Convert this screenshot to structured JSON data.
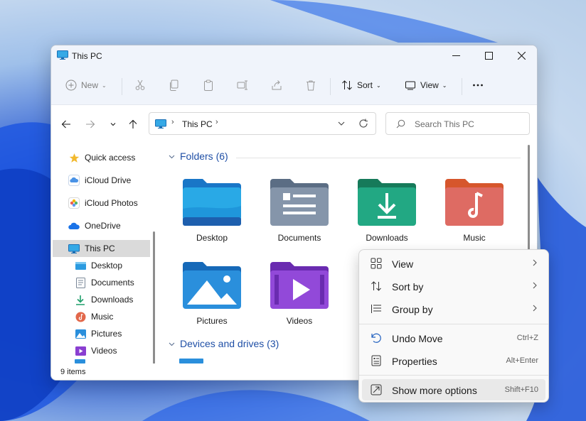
{
  "window": {
    "title": "This PC"
  },
  "toolbar": {
    "new_label": "New",
    "sort_label": "Sort",
    "view_label": "View"
  },
  "address": {
    "path_item": "This PC"
  },
  "search": {
    "placeholder": "Search This PC"
  },
  "sidebar": {
    "items": [
      {
        "label": "Quick access",
        "icon": "star-icon"
      },
      {
        "label": "iCloud Drive",
        "icon": "icloud-icon"
      },
      {
        "label": "iCloud Photos",
        "icon": "photos-icon"
      },
      {
        "label": "OneDrive",
        "icon": "onedrive-icon"
      },
      {
        "label": "This PC",
        "icon": "monitor-icon",
        "selected": true
      },
      {
        "label": "Desktop",
        "icon": "desktop-icon"
      },
      {
        "label": "Documents",
        "icon": "documents-icon"
      },
      {
        "label": "Downloads",
        "icon": "download-icon"
      },
      {
        "label": "Music",
        "icon": "music-icon"
      },
      {
        "label": "Pictures",
        "icon": "pictures-icon"
      },
      {
        "label": "Videos",
        "icon": "videos-icon"
      }
    ]
  },
  "main": {
    "folders_header": "Folders (6)",
    "drives_header": "Devices and drives (3)",
    "folders": [
      {
        "label": "Desktop"
      },
      {
        "label": "Documents"
      },
      {
        "label": "Downloads"
      },
      {
        "label": "Music"
      },
      {
        "label": "Pictures"
      },
      {
        "label": "Videos"
      }
    ]
  },
  "status": {
    "items_count": "9 items"
  },
  "context_menu": {
    "items": [
      {
        "label": "View",
        "icon": "grid-icon",
        "submenu": true
      },
      {
        "label": "Sort by",
        "icon": "sort-icon",
        "submenu": true
      },
      {
        "label": "Group by",
        "icon": "group-icon",
        "submenu": true
      },
      {
        "label": "Undo Move",
        "icon": "undo-icon",
        "shortcut": "Ctrl+Z"
      },
      {
        "label": "Properties",
        "icon": "properties-icon",
        "shortcut": "Alt+Enter"
      },
      {
        "label": "Show more options",
        "icon": "more-options-icon",
        "shortcut": "Shift+F10",
        "highlighted": true
      }
    ]
  },
  "colors": {
    "accent": "#1f4fa6",
    "selection": "#dadada",
    "wallpaper": "#1e4fcf"
  }
}
